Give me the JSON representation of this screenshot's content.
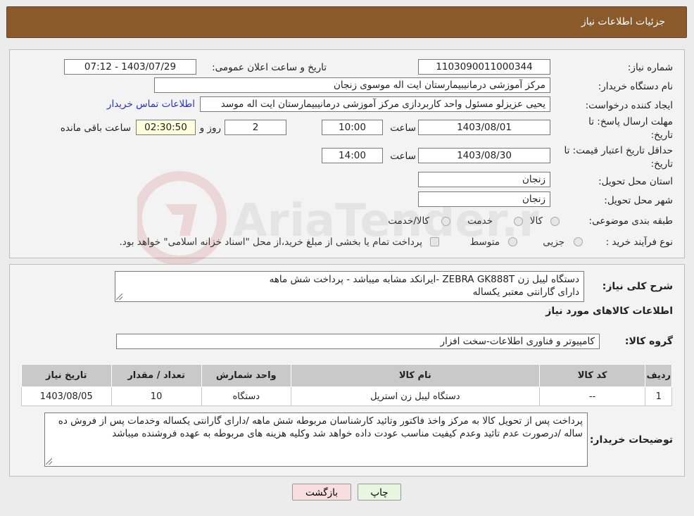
{
  "header": {
    "title": "جزئیات اطلاعات نیاز"
  },
  "form": {
    "need_number_label": "شماره نیاز:",
    "need_number": "1103090011000344",
    "announce_label": "تاریخ و ساعت اعلان عمومی:",
    "announce_value": "1403/07/29 - 07:12",
    "buyer_org_label": "نام دستگاه خریدار:",
    "buyer_org": "مرکز آموزشی درمانیبیمارستان ایت اله موسوی زنجان",
    "creator_label": "ایجاد کننده درخواست:",
    "creator": "یحیی عزیزلو مسئول واحد کاربردازی مرکز آموزشی درمانیبیمارستان ایت اله موسد",
    "contact_link": "اطلاعات تماس خریدار",
    "deadline_label_1": "مهلت ارسال پاسخ: تا",
    "deadline_label_2": "تاریخ:",
    "deadline_date": "1403/08/01",
    "time_label": "ساعت",
    "deadline_time": "10:00",
    "days_value": "2",
    "days_label": "روز و",
    "remaining_time": "02:30:50",
    "remaining_label": "ساعت باقی مانده",
    "price_validity_label_1": "حداقل تاریخ اعتبار قیمت: تا",
    "price_validity_label_2": "تاریخ:",
    "price_validity_date": "1403/08/30",
    "price_validity_time": "14:00",
    "province_label": "استان محل تحویل:",
    "province": "زنجان",
    "city_label": "شهر محل تحویل:",
    "city": "زنجان",
    "category_label": "طبقه بندی موضوعی:",
    "category_options": [
      "کالا",
      "خدمت",
      "کالا/خدمت"
    ],
    "process_label": "نوع فرآیند خرید :",
    "process_options": [
      "جزیی",
      "متوسط"
    ],
    "process_note": "پرداخت تمام یا بخشی از مبلغ خرید،از محل \"اسناد خزانه اسلامی\" خواهد بود."
  },
  "details": {
    "summary_label": "شرح کلی نیاز:",
    "summary_line1": "دستگاه لیبل زن ZEBRA GK888T -ایرانکد مشابه میباشد - پرداخت شش ماهه",
    "summary_line2": "دارای گارانتی معتبر یکساله",
    "goods_info_title": "اطلاعات کالاهای مورد نیاز",
    "goods_group_label": "گروه کالا:",
    "goods_group": "کامپیوتر و فناوری اطلاعات-سخت افزار",
    "table": {
      "headers": [
        "ردیف",
        "کد کالا",
        "نام کالا",
        "واحد شمارش",
        "تعداد / مقدار",
        "تاریخ نیاز"
      ],
      "rows": [
        [
          "1",
          "--",
          "دستگاه لیبل زن استریل",
          "دستگاه",
          "10",
          "1403/08/05"
        ]
      ]
    },
    "buyer_notes_label": "توضیحات خریدار:",
    "buyer_notes": "پرداخت پس از تحویل کالا به مرکز واخذ فاکتور وتائید کارشناسان مربوطه  شش ماهه /دارای گارانتی یکساله وخدمات پس از فروش ده ساله /درصورت عدم تائید وعدم کیفیت مناسب عودت داده خواهد شد وکلیه هزینه های مربوطه به عهده فروشنده میباشد"
  },
  "buttons": {
    "print": "چاپ",
    "back": "بازگشت"
  },
  "watermark_text": "AriaTender.net"
}
